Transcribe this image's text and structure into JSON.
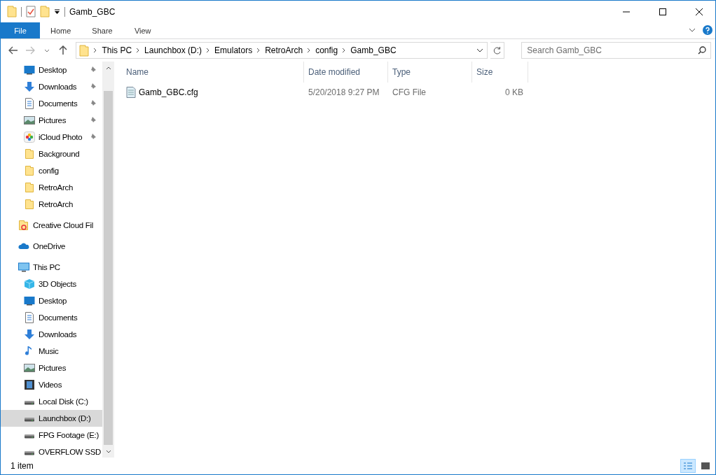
{
  "window": {
    "title": "Gamb_GBC"
  },
  "ribbon_tabs": [
    {
      "label": "File",
      "selected": true
    },
    {
      "label": "Home",
      "selected": false
    },
    {
      "label": "Share",
      "selected": false
    },
    {
      "label": "View",
      "selected": false
    }
  ],
  "breadcrumb": [
    "This PC",
    "Launchbox (D:)",
    "Emulators",
    "RetroArch",
    "config",
    "Gamb_GBC"
  ],
  "search": {
    "placeholder": "Search Gamb_GBC"
  },
  "quick_access": [
    {
      "label": "Desktop",
      "kind": "desktop",
      "pinned": true,
      "selected": false
    },
    {
      "label": "Downloads",
      "kind": "download",
      "pinned": true,
      "selected": false
    },
    {
      "label": "Documents",
      "kind": "document",
      "pinned": true,
      "selected": false
    },
    {
      "label": "Pictures",
      "kind": "picture",
      "pinned": true,
      "selected": false
    },
    {
      "label": "iCloud Photo",
      "kind": "photos",
      "pinned": true,
      "selected": false
    },
    {
      "label": "Background",
      "kind": "folder",
      "pinned": false,
      "selected": false
    },
    {
      "label": "config",
      "kind": "folder",
      "pinned": false,
      "selected": false
    },
    {
      "label": "RetroArch",
      "kind": "folder",
      "pinned": false,
      "selected": false
    },
    {
      "label": "RetroArch",
      "kind": "folder",
      "pinned": false,
      "selected": false
    }
  ],
  "sidebar_items": [
    {
      "label": "Creative Cloud Fil",
      "kind": "cloudfolder",
      "selected": false
    },
    {
      "label": "OneDrive",
      "kind": "cloud",
      "selected": false
    },
    {
      "label": "This PC",
      "kind": "pc",
      "selected": false,
      "children": [
        {
          "label": "3D Objects",
          "kind": "cube",
          "selected": false
        },
        {
          "label": "Desktop",
          "kind": "desktop",
          "selected": false
        },
        {
          "label": "Documents",
          "kind": "document",
          "selected": false
        },
        {
          "label": "Downloads",
          "kind": "download",
          "selected": false
        },
        {
          "label": "Music",
          "kind": "music",
          "selected": false
        },
        {
          "label": "Pictures",
          "kind": "picture",
          "selected": false
        },
        {
          "label": "Videos",
          "kind": "video",
          "selected": false
        },
        {
          "label": "Local Disk (C:)",
          "kind": "drive",
          "selected": false
        },
        {
          "label": "Launchbox (D:)",
          "kind": "drive",
          "selected": true
        },
        {
          "label": "FPG Footage (E:)",
          "kind": "drive",
          "selected": false
        },
        {
          "label": "OVERFLOW SSD",
          "kind": "drive",
          "selected": false
        }
      ]
    }
  ],
  "table": {
    "columns": [
      "Name",
      "Date modified",
      "Type",
      "Size"
    ],
    "rows": [
      {
        "name": "Gamb_GBC.cfg",
        "date": "5/20/2018 9:27 PM",
        "type": "CFG File",
        "size": "0 KB"
      }
    ]
  },
  "status_bar": {
    "count": "1 item"
  }
}
